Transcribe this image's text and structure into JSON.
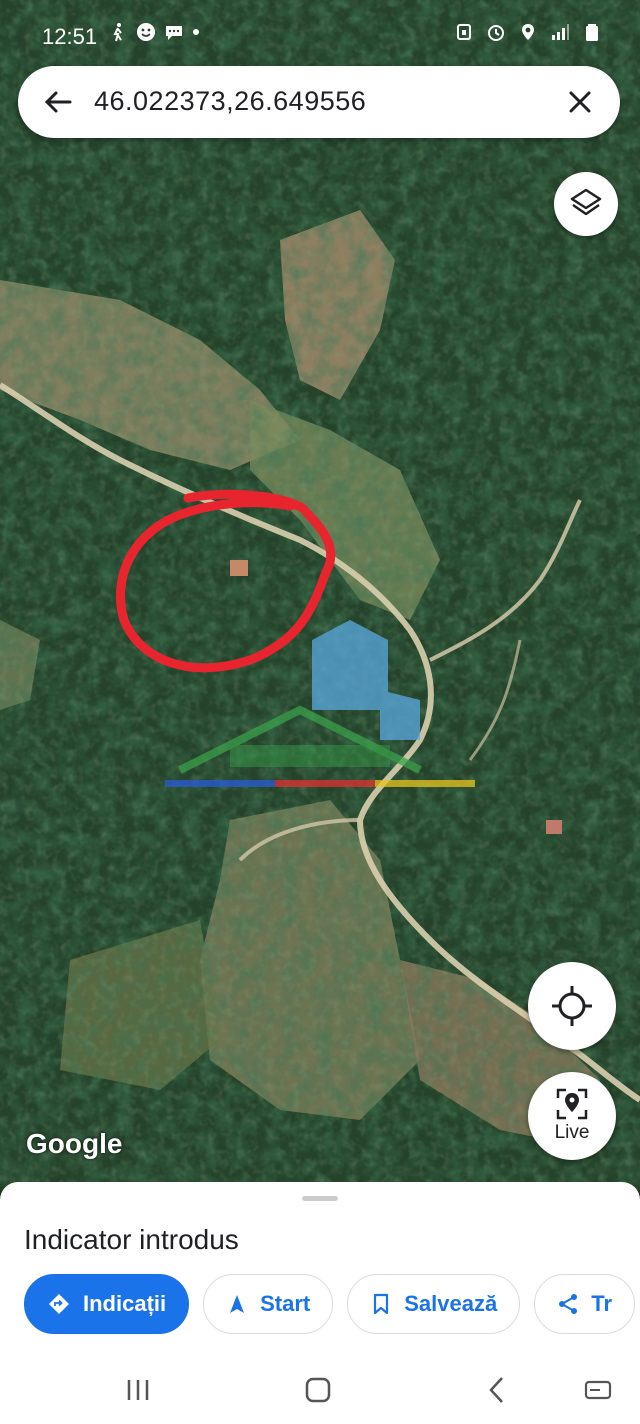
{
  "status_bar": {
    "time": "12:51"
  },
  "search": {
    "query": "46.022373,26.649556"
  },
  "map": {
    "attribution": "Google"
  },
  "buttons": {
    "live_label": "Live"
  },
  "sheet": {
    "title": "Indicator introdus",
    "actions": [
      {
        "label": "Indicații",
        "icon": "directions-icon"
      },
      {
        "label": "Start",
        "icon": "navigation-arrow-icon"
      },
      {
        "label": "Salvează",
        "icon": "bookmark-icon"
      },
      {
        "label": "Tr",
        "icon": "share-icon"
      }
    ]
  },
  "colors": {
    "accent": "#1a73e8",
    "annotation": "#e8252f"
  }
}
